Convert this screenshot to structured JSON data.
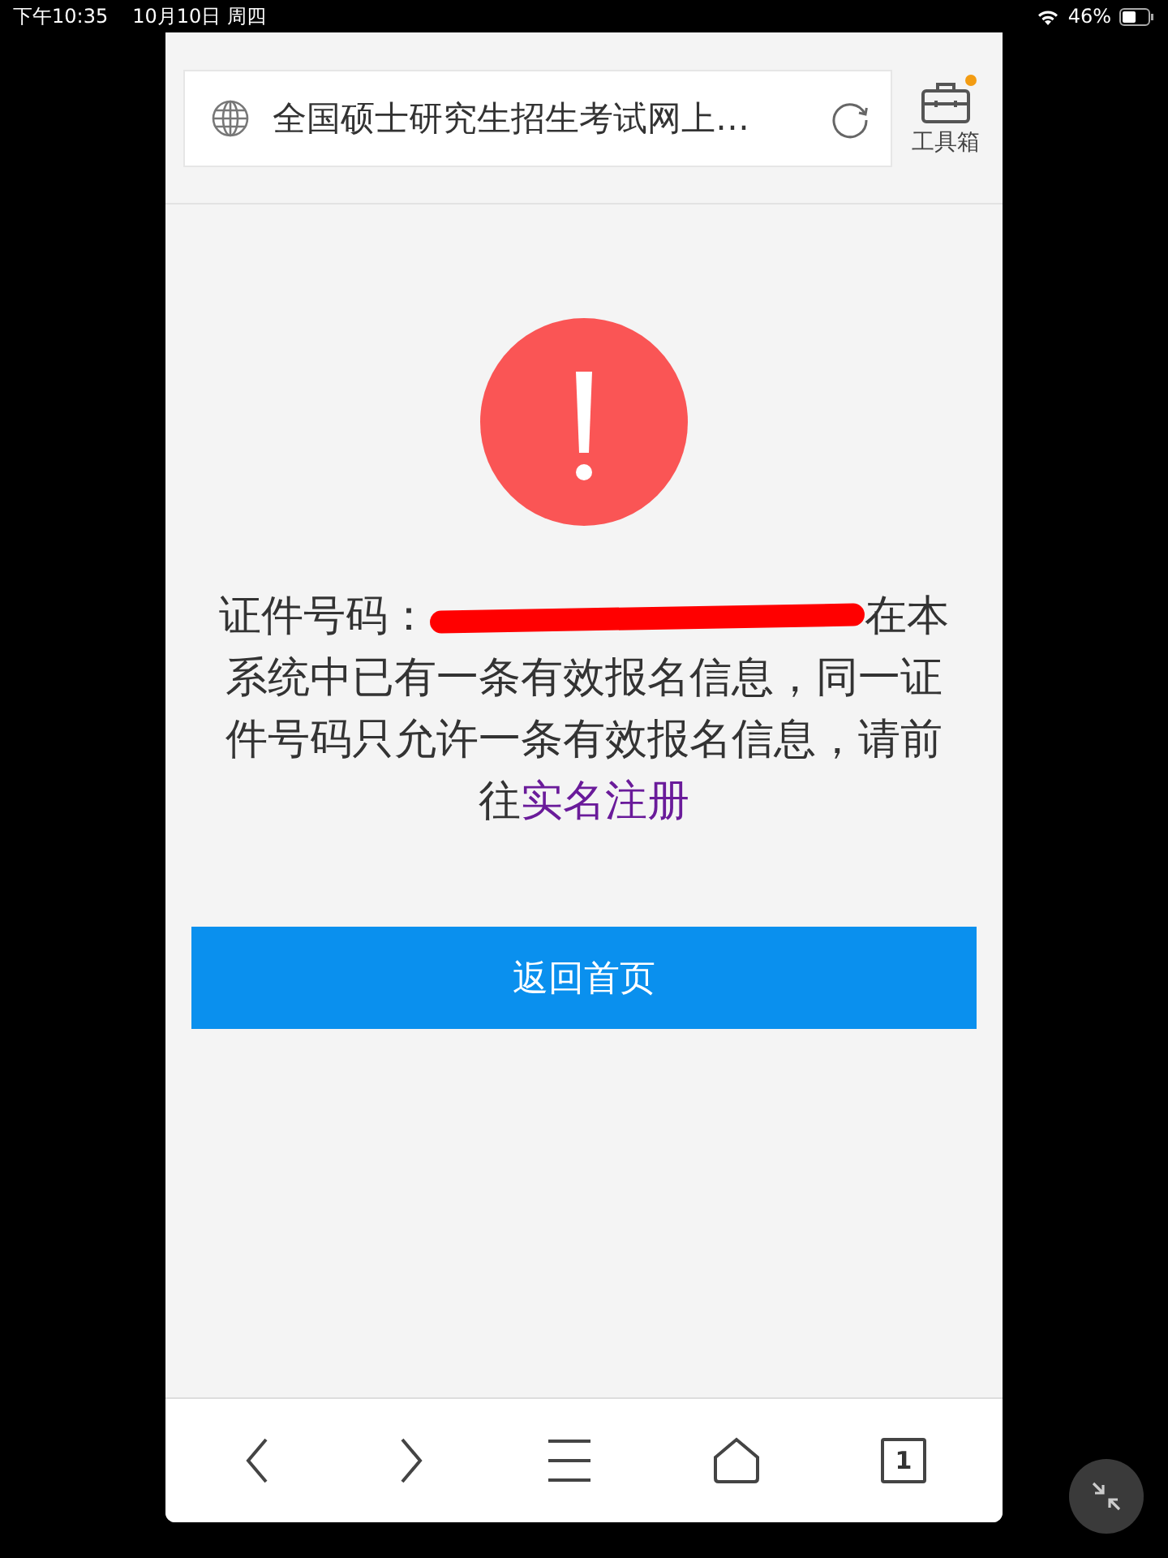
{
  "status_bar": {
    "time": "下午10:35",
    "date": "10月10日 周四",
    "battery": "46%"
  },
  "address_bar": {
    "title": "全国硕士研究生招生考试网上…"
  },
  "toolbox": {
    "label": "工具箱",
    "notification": true
  },
  "message": {
    "prefix": "证件号码：",
    "redacted": true,
    "text": "在本系统中已有一条有效报名信息，同一证件号码只允许一条有效报名信息，请前往",
    "link": "实名注册"
  },
  "button": {
    "label": "返回首页"
  },
  "bottom_nav": {
    "tab_count": "1"
  }
}
